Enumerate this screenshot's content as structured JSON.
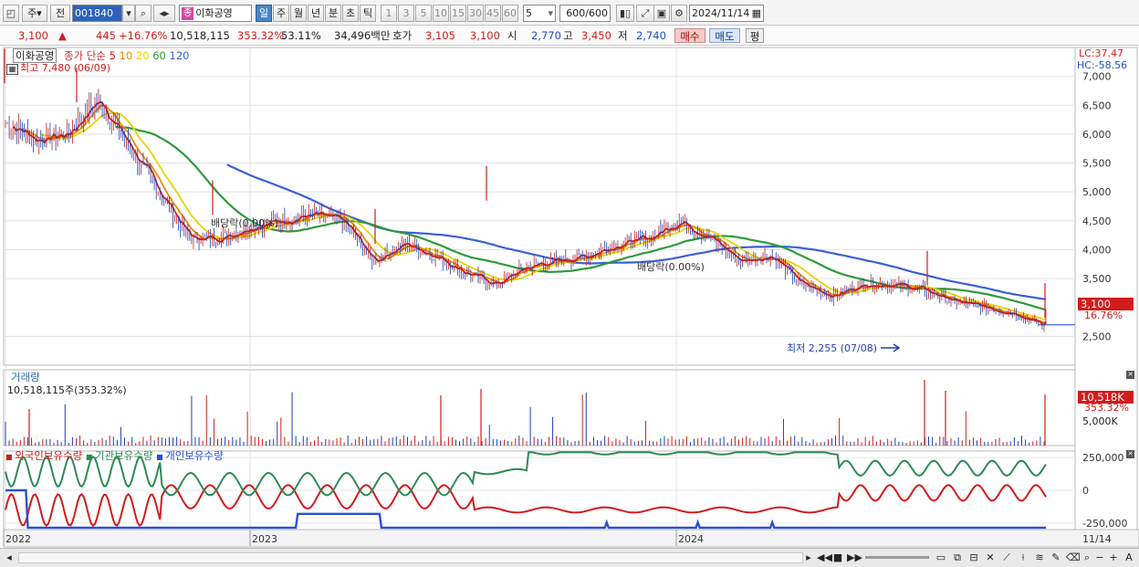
{
  "toolbar": {
    "period_prefix": "주",
    "market_prefix": "전",
    "stock_code": "001840",
    "stock_badge": "종",
    "stock_name": "이화공영",
    "periods": [
      "일",
      "주",
      "월",
      "년",
      "분",
      "초",
      "틱"
    ],
    "active_period": "일",
    "intervals": [
      "1",
      "3",
      "5",
      "10",
      "15",
      "30",
      "45",
      "60"
    ],
    "interval_value": "5",
    "count_value": "600",
    "count_total": "/600",
    "date": "2024/11/14"
  },
  "quote": {
    "price": "3,100",
    "change_arrow": "▲",
    "change": "445",
    "change_pct": "+16.76%",
    "volume": "10,518,115",
    "volume_ratio": "353.32%",
    "turnover_pct": "53.11%",
    "trade_value": "34,496백만",
    "ask_label": "호가",
    "ask1": "3,105",
    "ask2": "3,100",
    "open_label": "시",
    "open": "2,770",
    "high_label": "고",
    "high": "3,450",
    "low_label": "저",
    "low": "2,740",
    "buy_label": "매수",
    "sell_label": "매도",
    "avg_label": "평"
  },
  "price_pane": {
    "title": "이화공영",
    "ma_label": "종가 단순",
    "ma_periods": [
      "5",
      "10",
      "20",
      "60",
      "120"
    ],
    "ma_colors": [
      "#d21c1c",
      "#f08a00",
      "#e6d400",
      "#2e9a3c",
      "#3b5fd6"
    ],
    "lc_label": "LC:37.47",
    "hc_label": "HC:-58.56",
    "high_marker": "최고 7,480 (06/09)",
    "low_marker": "최저 2,255 (07/08)",
    "dividend_1": "배당락(0.00%)",
    "dividend_2": "배당락(0.00%)",
    "y_ticks": [
      "7,000",
      "6,500",
      "6,000",
      "5,500",
      "5,000",
      "4,500",
      "4,000",
      "3,500",
      "2,500"
    ],
    "price_tag": "3,100",
    "pct_tag": "16.76%"
  },
  "volume_pane": {
    "title": "거래량",
    "subtitle": "10,518,115주(353.32%)",
    "tag": "10,518K",
    "tag_pct": "353.32%",
    "y_tick": "5,000K"
  },
  "holdings_pane": {
    "series_labels": [
      "외국인보유수량",
      "기관보유수량",
      "개인보유수량"
    ],
    "series_colors": [
      "#d21c1c",
      "#2e8a55",
      "#2a4fd8"
    ],
    "y_ticks": [
      "250,000",
      "0",
      "-250,000"
    ]
  },
  "x_axis": {
    "labels": [
      "2022",
      "2023",
      "2024",
      "11/14"
    ]
  },
  "chart_data": {
    "type": "line",
    "x": [
      "2022-01",
      "2022-02",
      "2022-03",
      "2022-04",
      "2022-05",
      "2022-06",
      "2022-07",
      "2022-08",
      "2022-09",
      "2022-10",
      "2022-11",
      "2022-12",
      "2023-01",
      "2023-02",
      "2023-03",
      "2023-04",
      "2023-05",
      "2023-06",
      "2023-07",
      "2023-08",
      "2023-09",
      "2023-10",
      "2023-11",
      "2023-12",
      "2024-01",
      "2024-02",
      "2024-03",
      "2024-04",
      "2024-05",
      "2024-06",
      "2024-07",
      "2024-08",
      "2024-09",
      "2024-10",
      "2024-11"
    ],
    "series": [
      {
        "name": "종가",
        "values": [
          6200,
          5900,
          6000,
          6600,
          5800,
          5000,
          4200,
          4200,
          4400,
          4500,
          4600,
          4500,
          3800,
          4100,
          3900,
          3600,
          3400,
          3700,
          3800,
          3900,
          4100,
          4200,
          4500,
          4200,
          3800,
          3900,
          3400,
          3200,
          3400,
          3400,
          3300,
          3100,
          3000,
          2900,
          2650
        ]
      },
      {
        "name": "120",
        "values": [
          null,
          null,
          null,
          null,
          null,
          null,
          null,
          null,
          null,
          null,
          5300,
          5100,
          4900,
          4700,
          4500,
          4300,
          4200,
          4100,
          4050,
          4000,
          3950,
          3950,
          3950,
          3900,
          3850,
          3800,
          3700,
          3600,
          3450,
          3400,
          3300,
          3200,
          3100,
          2950,
          2750
        ]
      }
    ],
    "ylim": [
      2000,
      7500
    ]
  }
}
